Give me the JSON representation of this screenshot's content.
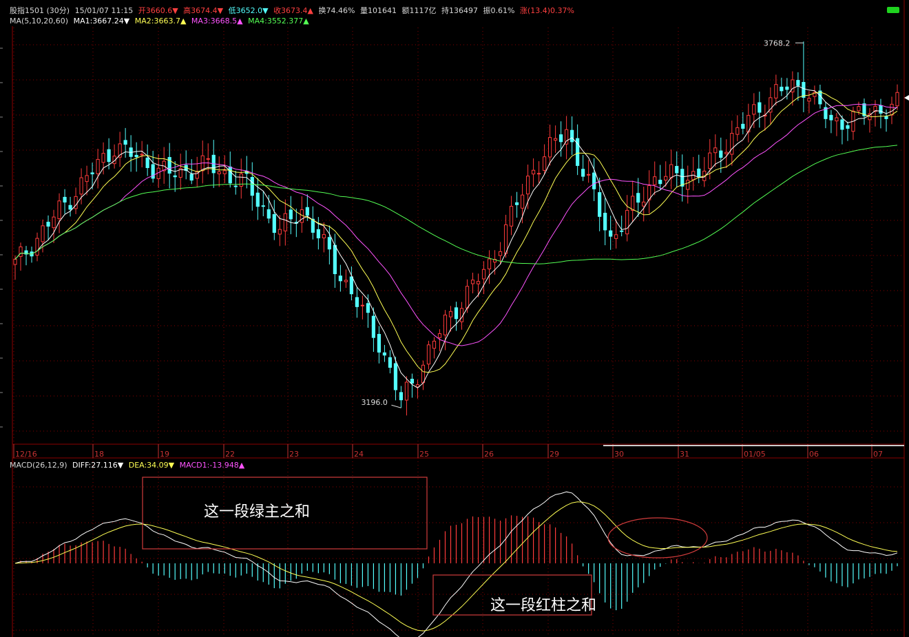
{
  "header": {
    "symbol": "股指1501",
    "period": "(30分)",
    "datetime": "15/01/07 11:15",
    "open": "开3660.6▼",
    "high": "高3674.4▼",
    "low": "低3652.0▼",
    "close": "收3673.4▲",
    "turnover": "换74.46%",
    "volume": "量101641",
    "amount": "额1117亿",
    "hold": "持136497",
    "amplitude": "振0.61%",
    "change": "涨(13.4)0.37%"
  },
  "ma_line": {
    "label": "MA(5,10,20,60)",
    "ma1": "MA1:3667.24▼",
    "ma2": "MA2:3663.7▲",
    "ma3": "MA3:3668.5▲",
    "ma4": "MA4:3552.377▲"
  },
  "macd_line": {
    "label": "MACD(26,12,9)",
    "diff": "DIFF:27.116▼",
    "dea": "DEA:34.09▼",
    "macd": "MACD1:-13.948▲"
  },
  "colors": {
    "background": "#000000",
    "up": "#ff3b3b",
    "down": "#54ffff",
    "ma1": "#ffffff",
    "ma2": "#ffff54",
    "ma3": "#ff54ff",
    "ma4": "#54ff54",
    "grid": "#8c0000",
    "axis_text": "#c83232"
  },
  "annotations": {
    "green_sum": "这一段绿主之和",
    "red_sum": "这一段红柱之和"
  },
  "chart_data": [
    {
      "type": "candlestick",
      "title": "股指1501 (30分)",
      "x_labels": [
        "12/16",
        "18",
        "19",
        "22",
        "23",
        "24",
        "25",
        "26",
        "29",
        "30",
        "31",
        "01/05",
        "06",
        "07"
      ],
      "ylim": [
        3150,
        3790
      ],
      "price_max_label": "3768.2",
      "price_min_label": "3196.0",
      "highest": 3768.2,
      "lowest": 3196.0,
      "series_waypoints": [
        [
          0,
          3420
        ],
        [
          10,
          3525
        ],
        [
          18,
          3605
        ],
        [
          28,
          3560
        ],
        [
          35,
          3575
        ],
        [
          42,
          3545
        ],
        [
          48,
          3470
        ],
        [
          52,
          3508
        ],
        [
          60,
          3390
        ],
        [
          66,
          3300
        ],
        [
          70,
          3205
        ],
        [
          78,
          3330
        ],
        [
          86,
          3420
        ],
        [
          94,
          3570
        ],
        [
          100,
          3630
        ],
        [
          108,
          3460
        ],
        [
          116,
          3555
        ],
        [
          124,
          3560
        ],
        [
          130,
          3620
        ],
        [
          138,
          3690
        ],
        [
          143,
          3700
        ],
        [
          148,
          3640
        ],
        [
          160,
          3670
        ]
      ],
      "ma_series": [
        {
          "name": "MA1",
          "lag": 2
        },
        {
          "name": "MA2",
          "lag": 5
        },
        {
          "name": "MA3",
          "lag": 10
        },
        {
          "name": "MA4",
          "lag": 30
        }
      ]
    },
    {
      "type": "bar",
      "title": "MACD(26,12,9)",
      "series": [
        {
          "name": "MACD1",
          "style": "histogram"
        },
        {
          "name": "DIFF",
          "style": "line"
        },
        {
          "name": "DEA",
          "style": "line"
        }
      ]
    }
  ]
}
